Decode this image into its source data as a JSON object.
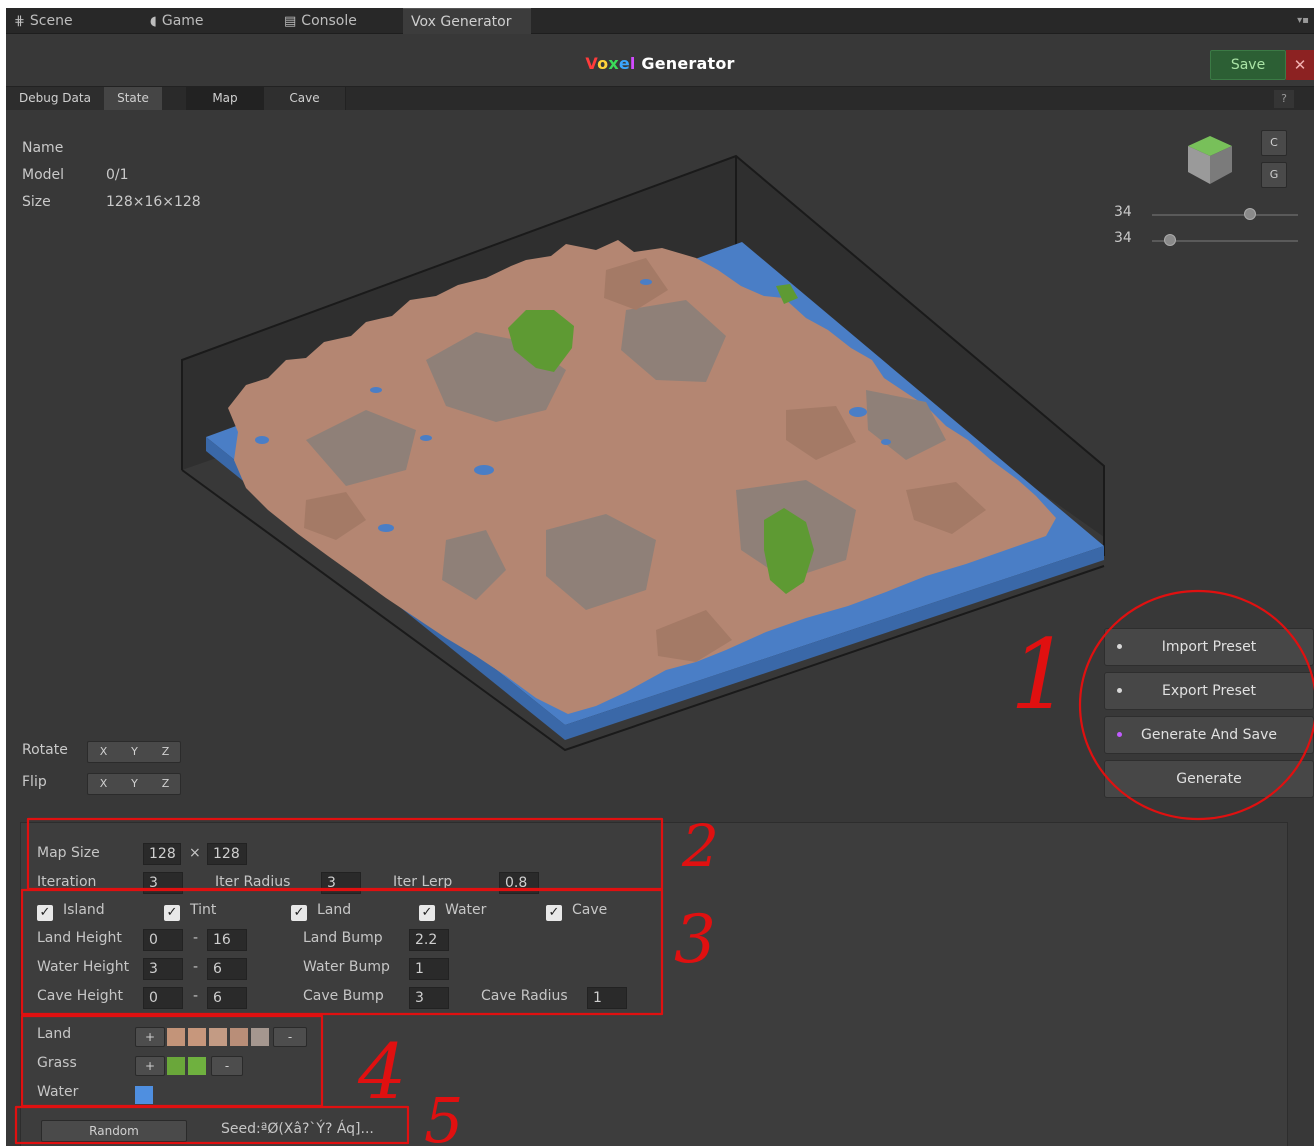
{
  "window_tabs": [
    {
      "label": "Scene",
      "icon": "grid-icon"
    },
    {
      "label": "Game",
      "icon": "pacman-icon"
    },
    {
      "label": "Console",
      "icon": "console-icon"
    },
    {
      "label": "Vox Generator",
      "icon": ""
    }
  ],
  "title": {
    "part1": "Voxel",
    "part2": " Generator"
  },
  "title_letter_colors": [
    "#ff3b3b",
    "#ffd43b",
    "#3bdc5a",
    "#3ba6ff",
    "#d24bff"
  ],
  "save_label": "Save",
  "close_label": "✕",
  "subtabs": [
    "Debug Data",
    "State",
    "Map",
    "Cave"
  ],
  "help_label": "?",
  "info": {
    "name_key": "Name",
    "model_key": "Model",
    "model_value": "0/1",
    "size_key": "Size",
    "size_value": "128×16×128"
  },
  "view_buttons": {
    "c": "C",
    "g": "G"
  },
  "sliders": [
    {
      "value": "34",
      "fraction": 0.67
    },
    {
      "value": "34",
      "fraction": 0.12
    }
  ],
  "rotate": {
    "label": "Rotate",
    "x": "X",
    "y": "Y",
    "z": "Z"
  },
  "flip": {
    "label": "Flip",
    "x": "X",
    "y": "Y",
    "z": "Z"
  },
  "actions": [
    "Import Preset",
    "Export Preset",
    "Generate And Save",
    "Generate"
  ],
  "action_dot_colors": [
    "#d8d8d8",
    "#d8d8d8",
    "#c15bff",
    ""
  ],
  "map": {
    "map_size_label": "Map Size",
    "map_size_w": "128",
    "times": "×",
    "map_size_h": "128",
    "iteration_label": "Iteration",
    "iteration": "3",
    "iter_radius_label": "Iter Radius",
    "iter_radius": "3",
    "iter_lerp_label": "Iter Lerp",
    "iter_lerp": "0.8"
  },
  "toggles": [
    "Island",
    "Tint",
    "Land",
    "Water",
    "Cave"
  ],
  "check_mark": "✓",
  "heights": {
    "land_height_label": "Land Height",
    "land_min": "0",
    "land_max": "16",
    "land_bump_label": "Land Bump",
    "land_bump": "2.2",
    "water_height_label": "Water Height",
    "water_min": "3",
    "water_max": "6",
    "water_bump_label": "Water Bump",
    "water_bump": "1",
    "cave_height_label": "Cave Height",
    "cave_min": "0",
    "cave_max": "6",
    "cave_bump_label": "Cave Bump",
    "cave_bump": "3",
    "cave_radius_label": "Cave Radius",
    "cave_radius": "1",
    "dash": "-"
  },
  "palette": {
    "land_label": "Land",
    "land_colors": [
      "#c39479",
      "#c7977c",
      "#c39b84",
      "#b98e78",
      "#a5978f"
    ],
    "grass_label": "Grass",
    "grass_colors": [
      "#6aa73a",
      "#6fb13f"
    ],
    "water_label": "Water",
    "water_color": "#4f8fe0",
    "plus": "+",
    "minus": "-"
  },
  "random_label": "Random",
  "seed_text": "Seed:ªØ(Xâ?`Ý? Áq]...",
  "annotations": [
    "1",
    "2",
    "3",
    "4",
    "5"
  ],
  "terrain_colors": {
    "water": "#4a7ec6",
    "land_a": "#b48672",
    "land_b": "#a47a66",
    "land_c": "#8f8078",
    "grass": "#5e9a33"
  }
}
